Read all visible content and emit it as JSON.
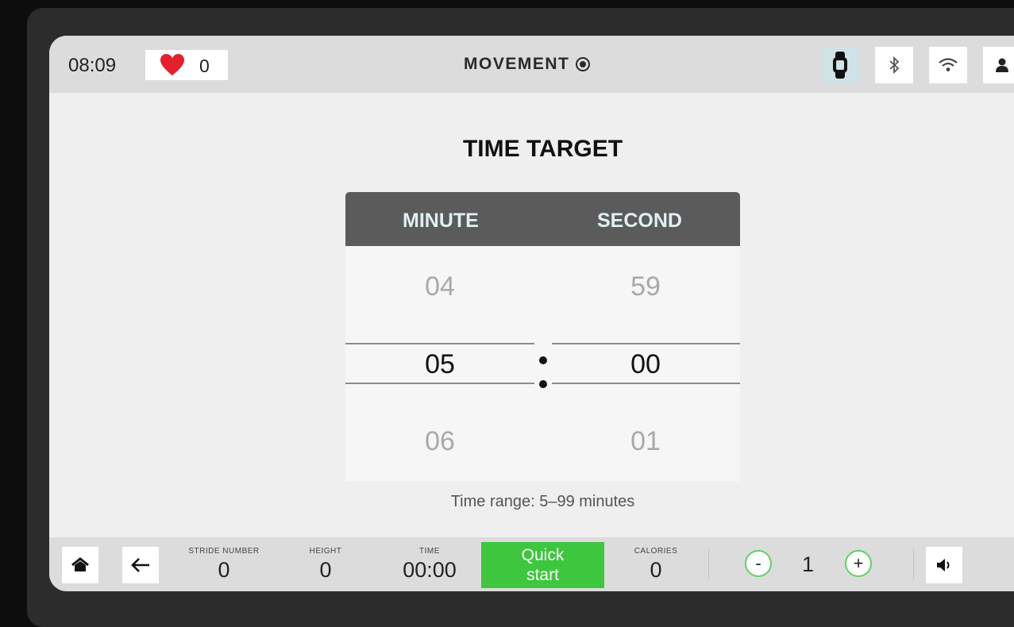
{
  "status": {
    "time": "08:09",
    "heart_rate": "0",
    "brand": "MOVEMENT",
    "icons": [
      "watch-icon",
      "bluetooth-icon",
      "wifi-icon",
      "user-icon"
    ],
    "active_icon": "watch-icon"
  },
  "main": {
    "title": "TIME TARGET",
    "picker": {
      "minute_header": "MINUTE",
      "second_header": "SECOND",
      "minute_prev": "04",
      "minute_selected": "05",
      "minute_next": "06",
      "second_prev": "59",
      "second_selected": "00",
      "second_next": "01"
    },
    "range_text": "Time range: 5–99 minutes"
  },
  "bottom": {
    "stride_label": "STRIDE NUMBER",
    "stride_value": "0",
    "height_label": "HEIGHT",
    "height_value": "0",
    "time_label": "TIME",
    "time_value": "00:00",
    "quick_start_line1": "Quick",
    "quick_start_line2": "start",
    "calories_label": "CALORIES",
    "calories_value": "0",
    "minus": "-",
    "level": "1",
    "plus": "+"
  },
  "colors": {
    "accent_green": "#3ec63e",
    "header_gray": "#5b5b5b",
    "heart_red": "#e4202c"
  }
}
